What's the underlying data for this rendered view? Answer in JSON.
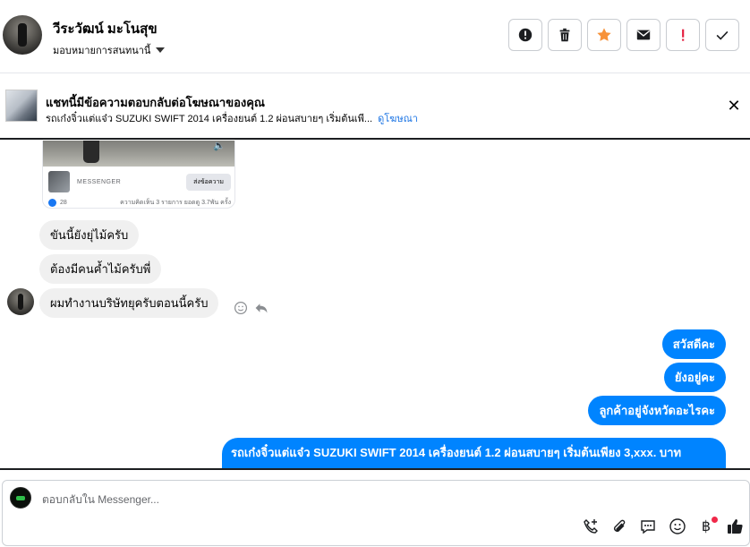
{
  "header": {
    "name": "วีระวัฒน์ มะโนสุข",
    "assign_label": "มอบหมายการสนทนานี้",
    "actions": [
      {
        "name": "report-icon",
        "color": "#1c1e21"
      },
      {
        "name": "trash-icon",
        "color": "#1c1e21"
      },
      {
        "name": "star-icon",
        "color": "#f7923a"
      },
      {
        "name": "envelope-icon",
        "color": "#1c1e21"
      },
      {
        "name": "exclamation-icon",
        "color": "#e41e3f"
      },
      {
        "name": "checkmark-icon",
        "color": "#1c1e21"
      }
    ]
  },
  "banner": {
    "title": "แชทนี้มีข้อความตอบกลับต่อโฆษณาของคุณ",
    "description": "รถเก๋งจิ๋วแต่แจ๋ว SUZUKI SWIFT 2014 เครื่องยนต์ 1.2 ผ่อนสบายๆ เริ่มต้นเพี...",
    "link": "ดูโฆษณา"
  },
  "ad_card": {
    "source": "MESSENGER",
    "button": "ส่งข้อความ",
    "likes": "28",
    "stats": "ความคิดเห็น 3 รายการ ยอดดู 3.7พัน ครั้ง"
  },
  "messages": {
    "incoming": [
      "ขันนี้ยังยุ่ไม้ครับ",
      "ต้องมีคนค้ำไม้ครับพี่",
      "ผมทำงานบริษัทยุครับตอนนี้ครับ"
    ],
    "outgoing": [
      "สวัสดีคะ",
      "ยังอยู่คะ",
      "ลูกค้าอยู่จังหวัดอะไรคะ"
    ],
    "outgoing_long": "รถเก๋งจิ๋วแต่แจ๋ว SUZUKI SWIFT 2014 เครื่องยนต์ 1.2 ผ่อนสบายๆ เริ่มต้นเพียง 3,xxx. บาท"
  },
  "composer": {
    "placeholder": "ตอบกลับใน Messenger...",
    "tools": [
      "add-call-icon",
      "paperclip-icon",
      "saved-reply-icon",
      "emoji-icon",
      "baht-icon",
      "thumbs-up-icon"
    ],
    "accent": "#1877f2"
  }
}
